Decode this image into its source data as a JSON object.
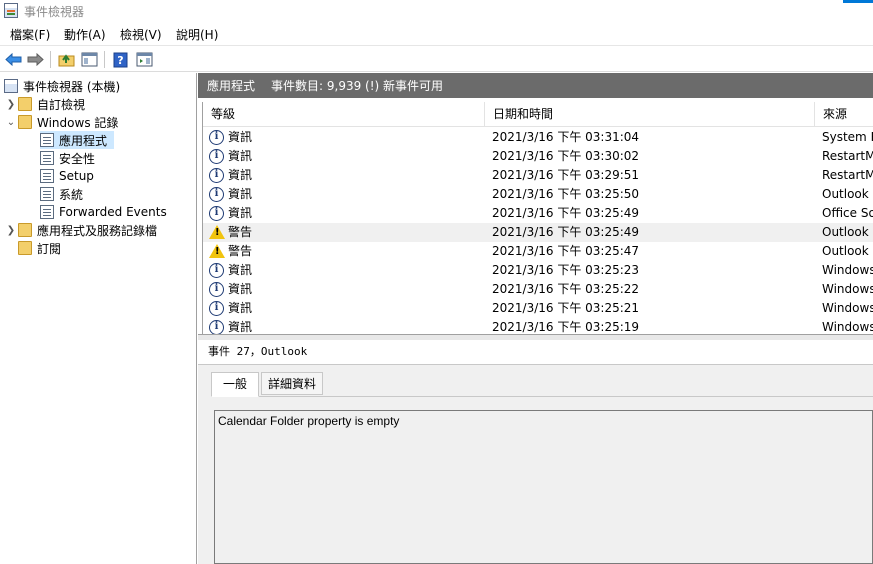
{
  "window": {
    "title": "事件檢視器"
  },
  "menu": [
    {
      "label": "檔案(F)"
    },
    {
      "label": "動作(A)"
    },
    {
      "label": "檢視(V)"
    },
    {
      "label": "說明(H)"
    }
  ],
  "toolbar": {
    "icons": [
      "back-arrow-icon",
      "forward-arrow-icon",
      "folder-up-icon",
      "show-hide-tree-icon",
      "help-icon",
      "show-action-pane-icon"
    ]
  },
  "tree": {
    "root": "事件檢視器 (本機)",
    "custom_views": "自訂檢視",
    "windows_logs": "Windows 記錄",
    "application": "應用程式",
    "security": "安全性",
    "setup": "Setup",
    "system": "系統",
    "forwarded": "Forwarded Events",
    "app_service_logs": "應用程式及服務記錄檔",
    "subscriptions": "訂閱"
  },
  "log_header": {
    "title": "應用程式",
    "count": "事件數目: 9,939 (!) 新事件可用"
  },
  "columns": {
    "level": "等級",
    "datetime": "日期和時間",
    "source": "來源"
  },
  "events": [
    {
      "level": "資訊",
      "type": "info",
      "datetime": "2021/3/16 下午 03:31:04",
      "source": "System R"
    },
    {
      "level": "資訊",
      "type": "info",
      "datetime": "2021/3/16 下午 03:30:02",
      "source": "RestartM"
    },
    {
      "level": "資訊",
      "type": "info",
      "datetime": "2021/3/16 下午 03:29:51",
      "source": "RestartM"
    },
    {
      "level": "資訊",
      "type": "info",
      "datetime": "2021/3/16 下午 03:25:50",
      "source": "Outlook"
    },
    {
      "level": "資訊",
      "type": "info",
      "datetime": "2021/3/16 下午 03:25:49",
      "source": "Office So"
    },
    {
      "level": "警告",
      "type": "warning",
      "datetime": "2021/3/16 下午 03:25:49",
      "source": "Outlook"
    },
    {
      "level": "警告",
      "type": "warning",
      "datetime": "2021/3/16 下午 03:25:47",
      "source": "Outlook"
    },
    {
      "level": "資訊",
      "type": "info",
      "datetime": "2021/3/16 下午 03:25:23",
      "source": "Windows"
    },
    {
      "level": "資訊",
      "type": "info",
      "datetime": "2021/3/16 下午 03:25:22",
      "source": "Windows"
    },
    {
      "level": "資訊",
      "type": "info",
      "datetime": "2021/3/16 下午 03:25:21",
      "source": "Windows"
    },
    {
      "level": "資訊",
      "type": "info",
      "datetime": "2021/3/16 下午 03:25:19",
      "source": "Windows"
    }
  ],
  "detail": {
    "title": "事件 27，Outlook",
    "tab_general": "一般",
    "tab_details": "詳細資料",
    "description": "Calendar Folder property is empty"
  }
}
